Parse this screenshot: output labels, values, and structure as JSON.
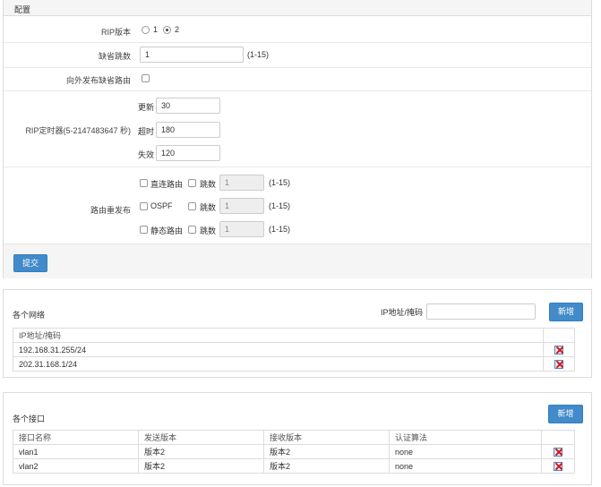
{
  "config": {
    "title": "配置",
    "rip_version": {
      "label": "RIP版本",
      "options": [
        "1",
        "2"
      ],
      "selected": "2"
    },
    "default_metric": {
      "label": "缺省跳数",
      "value": "1",
      "range": "(1-15)"
    },
    "default_route": {
      "label": "向外发布缺省路由",
      "checked": false
    },
    "timers": {
      "label": "RIP定时器(5-2147483647 秒)",
      "update": {
        "label": "更新",
        "value": "30"
      },
      "timeout": {
        "label": "超时",
        "value": "180"
      },
      "invalid": {
        "label": "失效",
        "value": "120"
      }
    },
    "redistribute": {
      "label": "路由重发布",
      "metric_label": "跳数",
      "range": "(1-15)",
      "rows": [
        {
          "name": "直连路由",
          "metric": "1"
        },
        {
          "name": "OSPF",
          "metric": "1"
        },
        {
          "name": "静态路由",
          "metric": "1"
        }
      ]
    },
    "submit": "提交"
  },
  "networks": {
    "title": "各个网络",
    "input_label": "IP地址/掩码",
    "input_value": "",
    "add": "新增",
    "column": "IP地址/掩码",
    "rows": [
      "192.168.31.255/24",
      "202.31.168.1/24"
    ]
  },
  "interfaces": {
    "title": "各个接口",
    "add": "新增",
    "columns": [
      "接口名称",
      "发送版本",
      "接收版本",
      "认证算法"
    ],
    "rows": [
      {
        "name": "vlan1",
        "send": "版本2",
        "recv": "版本2",
        "auth": "none"
      },
      {
        "name": "vlan2",
        "send": "版本2",
        "recv": "版本2",
        "auth": "none"
      }
    ]
  },
  "colors": {
    "primary": "#428bca",
    "link": "#2a6db5",
    "delete": "#d01a1a"
  }
}
